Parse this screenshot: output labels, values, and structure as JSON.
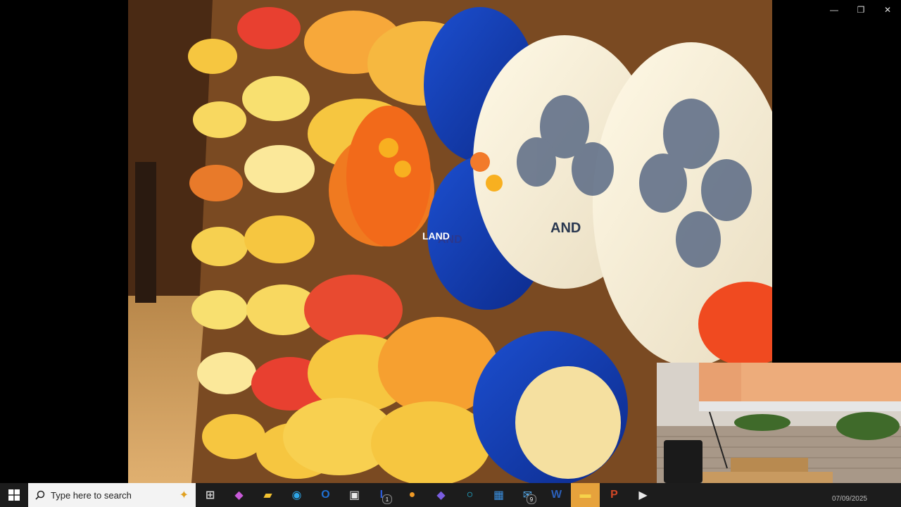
{
  "window": {
    "controls": {
      "minimize": "—",
      "restore": "❐",
      "close": "✕"
    }
  },
  "slide": {
    "stamp_lines": [
      "AND",
      "AND",
      "LAND"
    ]
  },
  "taskbar": {
    "search_placeholder": "Type here to search",
    "apps": [
      {
        "name": "task-view",
        "glyph": "⊞",
        "color": "#cfcfcf"
      },
      {
        "name": "copilot",
        "glyph": "◆",
        "color": "#c85ad8"
      },
      {
        "name": "file-explorer",
        "glyph": "▰",
        "color": "#f2c230"
      },
      {
        "name": "edge",
        "glyph": "◉",
        "color": "#2ea6e8"
      },
      {
        "name": "outlook",
        "glyph": "O",
        "color": "#1f6fd1"
      },
      {
        "name": "store",
        "glyph": "▣",
        "color": "#e9e9e9"
      },
      {
        "name": "lync",
        "glyph": "L",
        "color": "#2c5bd6",
        "badge": "1"
      },
      {
        "name": "app-orange",
        "glyph": "●",
        "color": "#f09a26"
      },
      {
        "name": "copilot-pro",
        "glyph": "◆",
        "color": "#7a5de0"
      },
      {
        "name": "cortana",
        "glyph": "○",
        "color": "#22b5d8"
      },
      {
        "name": "calculator",
        "glyph": "▦",
        "color": "#3a8fe0"
      },
      {
        "name": "mail",
        "glyph": "✉",
        "color": "#53a8e8",
        "badge": "9"
      },
      {
        "name": "word",
        "glyph": "W",
        "color": "#2b5fb8"
      },
      {
        "name": "sticky-notes",
        "glyph": "▬",
        "color": "#f6d34b",
        "active": true
      },
      {
        "name": "powerpoint",
        "glyph": "P",
        "color": "#d24726"
      },
      {
        "name": "media-player",
        "glyph": "▶",
        "color": "#e9e9e9"
      }
    ],
    "clock": "07/09/2025"
  }
}
